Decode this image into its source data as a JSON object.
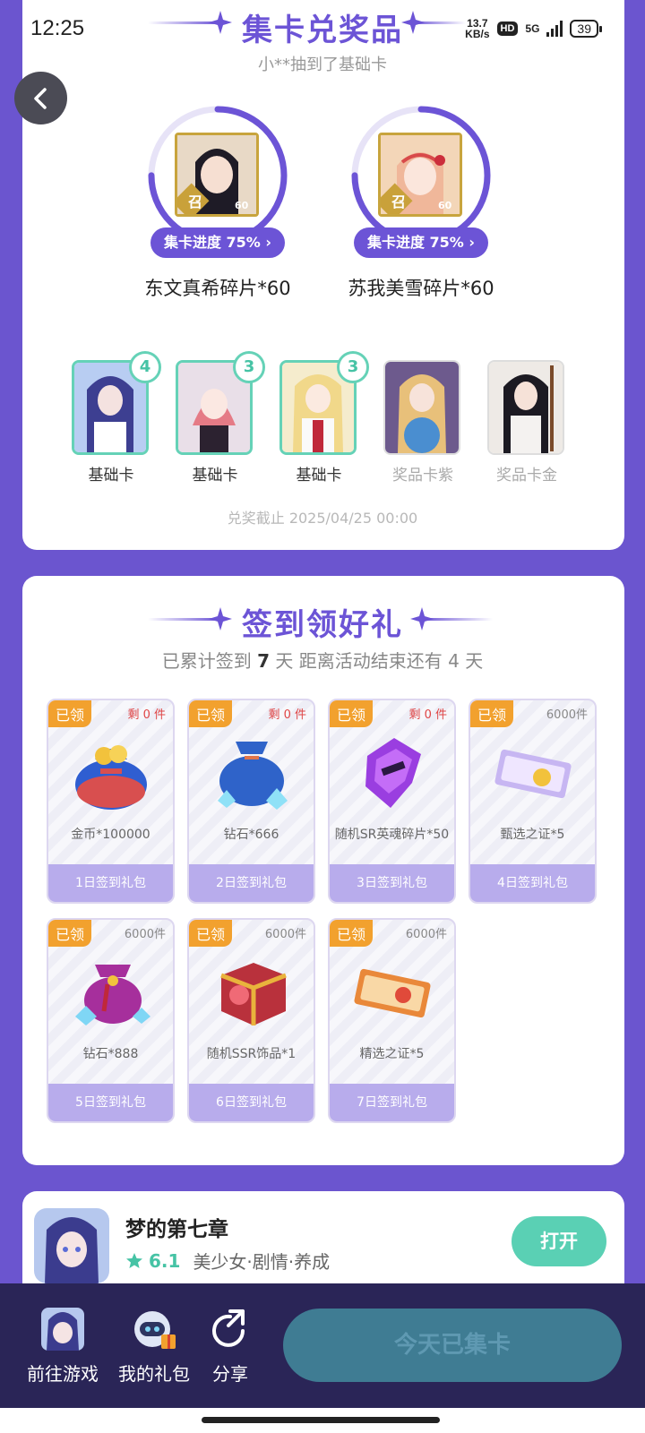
{
  "status_bar": {
    "time": "12:25",
    "net_speed_value": "13.7",
    "net_speed_unit": "KB/s",
    "hd": "HD",
    "network": "5G",
    "battery": "39"
  },
  "collect": {
    "title": "集卡兑奖品",
    "ticker": "小**抽到了基础卡",
    "prizes": [
      {
        "progress_label": "集卡进度 75%",
        "name": "东文真希碎片*60",
        "progress": 0.75,
        "badge_char": "召",
        "badge_num": "60"
      },
      {
        "progress_label": "集卡进度 75%",
        "name": "苏我美雪碎片*60",
        "progress": 0.75,
        "badge_char": "召",
        "badge_num": "60"
      }
    ],
    "cards": [
      {
        "label": "基础卡",
        "count": "4"
      },
      {
        "label": "基础卡",
        "count": "3"
      },
      {
        "label": "基础卡",
        "count": "3"
      },
      {
        "label": "奖品卡紫",
        "count": ""
      },
      {
        "label": "奖品卡金",
        "count": ""
      }
    ],
    "deadline": "兑奖截止 2025/04/25 00:00"
  },
  "checkin": {
    "title": "签到领好礼",
    "summary_prefix": "已累计签到",
    "days_count": "7",
    "summary_days": "天",
    "summary_suffix": "距离活动结束还有 4 天",
    "gifts": [
      {
        "tag": "已领",
        "remain": "剩 0 件",
        "name": "金币*100000",
        "foot": "1日签到礼包"
      },
      {
        "tag": "已领",
        "remain": "剩 0 件",
        "name": "钻石*666",
        "foot": "2日签到礼包"
      },
      {
        "tag": "已领",
        "remain": "剩 0 件",
        "name": "随机SR英魂碎片*50",
        "foot": "3日签到礼包"
      },
      {
        "tag": "已领",
        "remain": "6000件",
        "name": "甄选之证*5",
        "foot": "4日签到礼包"
      },
      {
        "tag": "已领",
        "remain": "6000件",
        "name": "钻石*888",
        "foot": "5日签到礼包"
      },
      {
        "tag": "已领",
        "remain": "6000件",
        "name": "随机SSR饰品*1",
        "foot": "6日签到礼包"
      },
      {
        "tag": "已领",
        "remain": "6000件",
        "name": "精选之证*5",
        "foot": "7日签到礼包"
      }
    ]
  },
  "game": {
    "name": "梦的第七章",
    "score": "6.1",
    "tags": "美少女·剧情·养成",
    "open_label": "打开"
  },
  "bottom": {
    "goto_game": "前往游戏",
    "my_gifts": "我的礼包",
    "share": "分享",
    "collect_label": "今天已集卡"
  },
  "colors": {
    "accent": "#6c54d6",
    "teal": "#5ad0b4",
    "tag_orange": "#f2a12e",
    "dark_bar": "#2a2557"
  }
}
